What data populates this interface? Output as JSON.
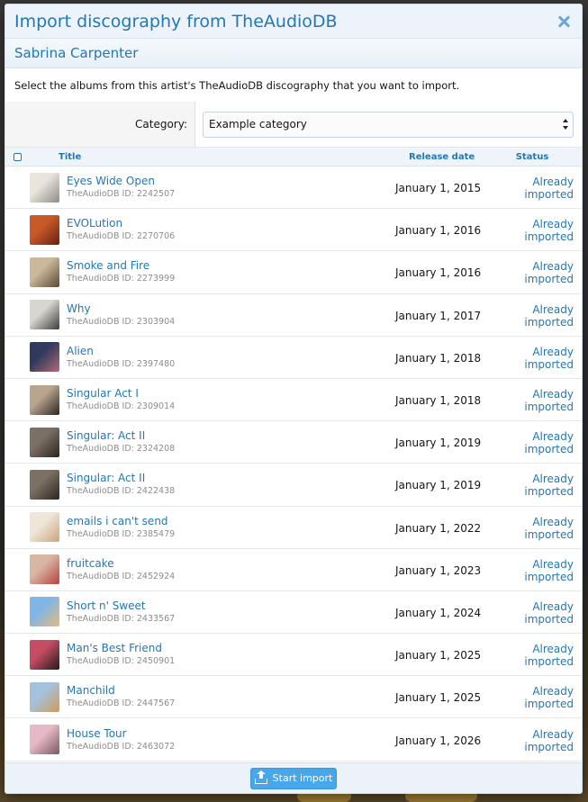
{
  "overlay": {
    "title": "Import discography from TheAudioDB",
    "close_icon": "close-icon"
  },
  "artist": {
    "name": "Sabrina Carpenter"
  },
  "explain": "Select the albums from this artist's TheAudioDB discography that you want to import.",
  "form": {
    "category_label": "Category:",
    "category_value": "Example category"
  },
  "table": {
    "headers": {
      "title": "Title",
      "release_date": "Release date",
      "status": "Status"
    },
    "rows": [
      {
        "title": "Eyes Wide Open",
        "id": "TheAudioDB ID: 2242507",
        "date": "January 1, 2015",
        "status": "Already imported",
        "thumb": [
          "#e9e4dc",
          "#8e8c86"
        ]
      },
      {
        "title": "EVOLution",
        "id": "TheAudioDB ID: 2270706",
        "date": "January 1, 2016",
        "status": "Already imported",
        "thumb": [
          "#c85a28",
          "#6a1f12"
        ]
      },
      {
        "title": "Smoke and Fire",
        "id": "TheAudioDB ID: 2273999",
        "date": "January 1, 2016",
        "status": "Already imported",
        "thumb": [
          "#c9b899",
          "#5b4a37"
        ]
      },
      {
        "title": "Why",
        "id": "TheAudioDB ID: 2303904",
        "date": "January 1, 2017",
        "status": "Already imported",
        "thumb": [
          "#d8d6d0",
          "#3f3c38"
        ]
      },
      {
        "title": "Alien",
        "id": "TheAudioDB ID: 2397480",
        "date": "January 1, 2018",
        "status": "Already imported",
        "thumb": [
          "#2f3a5c",
          "#b56a74"
        ]
      },
      {
        "title": "Singular Act I",
        "id": "TheAudioDB ID: 2309014",
        "date": "January 1, 2018",
        "status": "Already imported",
        "thumb": [
          "#b9a48e",
          "#2c2622"
        ]
      },
      {
        "title": "Singular: Act II",
        "id": "TheAudioDB ID: 2324208",
        "date": "January 1, 2019",
        "status": "Already imported",
        "thumb": [
          "#7c7064",
          "#2a2520"
        ]
      },
      {
        "title": "Singular: Act II",
        "id": "TheAudioDB ID: 2422438",
        "date": "January 1, 2019",
        "status": "Already imported",
        "thumb": [
          "#7c7064",
          "#2a2520"
        ]
      },
      {
        "title": "emails i can't send",
        "id": "TheAudioDB ID: 2385479",
        "date": "January 1, 2022",
        "status": "Already imported",
        "thumb": [
          "#f0e6d8",
          "#c9a47e"
        ]
      },
      {
        "title": "fruitcake",
        "id": "TheAudioDB ID: 2452924",
        "date": "January 1, 2023",
        "status": "Already imported",
        "thumb": [
          "#d8b6a4",
          "#b8413c"
        ]
      },
      {
        "title": "Short n' Sweet",
        "id": "TheAudioDB ID: 2433567",
        "date": "January 1, 2024",
        "status": "Already imported",
        "thumb": [
          "#7fb6e6",
          "#e7b97c"
        ]
      },
      {
        "title": "Man's Best Friend",
        "id": "TheAudioDB ID: 2450901",
        "date": "January 1, 2025",
        "status": "Already imported",
        "thumb": [
          "#c44c63",
          "#241b1c"
        ]
      },
      {
        "title": "Manchild",
        "id": "TheAudioDB ID: 2447567",
        "date": "January 1, 2025",
        "status": "Already imported",
        "thumb": [
          "#a4c2dc",
          "#d49a5a"
        ]
      },
      {
        "title": "House Tour",
        "id": "TheAudioDB ID: 2463072",
        "date": "January 1, 2026",
        "status": "Already imported",
        "thumb": [
          "#e7b9c7",
          "#7a5a63"
        ]
      }
    ]
  },
  "footer": {
    "submit_label": "Start import",
    "submit_icon": "import-icon"
  },
  "colors": {
    "accent": "#2577b1",
    "button": "#47a7eb"
  }
}
